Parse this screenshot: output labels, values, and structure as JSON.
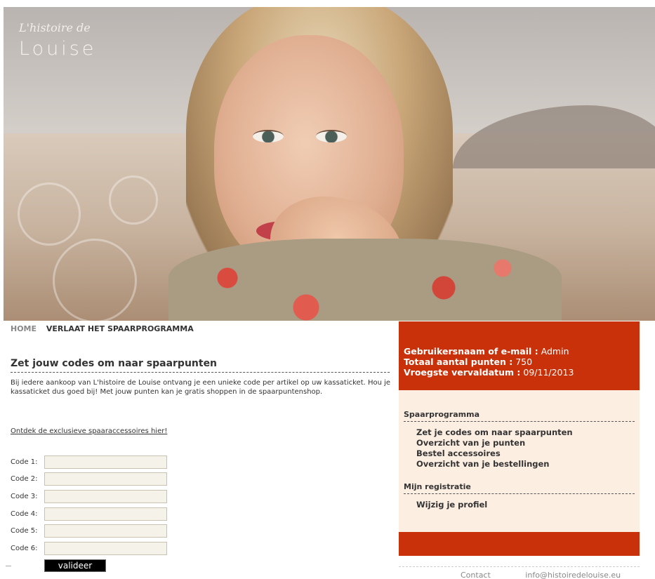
{
  "logo": {
    "script": "L'histoire de",
    "main": "Louise"
  },
  "nav": {
    "home": "HOME",
    "leave": "VERLAAT HET SPAARPROGRAMMA"
  },
  "main": {
    "title": "Zet jouw codes om naar spaarpunten",
    "intro": "Bij iedere aankoop van L'histoire de Louise ontvang je een unieke code per artikel op uw kassaticket. Hou je kassaticket dus goed bij! Met jouw punten kan je gratis shoppen in de spaarpuntenshop.",
    "discover": "Ontdek de exclusieve spaaraccessoires hier!",
    "codes": [
      {
        "label": "Code 1:",
        "value": ""
      },
      {
        "label": "Code 2:",
        "value": ""
      },
      {
        "label": "Code 3:",
        "value": ""
      },
      {
        "label": "Code 4:",
        "value": ""
      },
      {
        "label": "Code 5:",
        "value": ""
      },
      {
        "label": "Code 6:",
        "value": ""
      }
    ],
    "submit": "valideer"
  },
  "user": {
    "name_label": "Gebruikersnaam of e-mail :",
    "name_value": "Admin",
    "points_label": "Totaal aantal punten :",
    "points_value": "750",
    "expiry_label": "Vroegste vervaldatum :",
    "expiry_value": "09/11/2013"
  },
  "sidebar": {
    "section1": "Spaarprogramma",
    "items1": [
      "Zet je codes om naar spaarpunten",
      "Overzicht van je punten",
      "Bestel accessoires",
      "Overzicht van je bestellingen"
    ],
    "section2": "Mijn registratie",
    "items2": [
      "Wijzig je profiel"
    ]
  },
  "footer": {
    "contact": "Contact",
    "email": "info@histoiredelouise.eu"
  },
  "colors": {
    "accent": "#c9310b",
    "menu_bg": "#fdeee2"
  }
}
